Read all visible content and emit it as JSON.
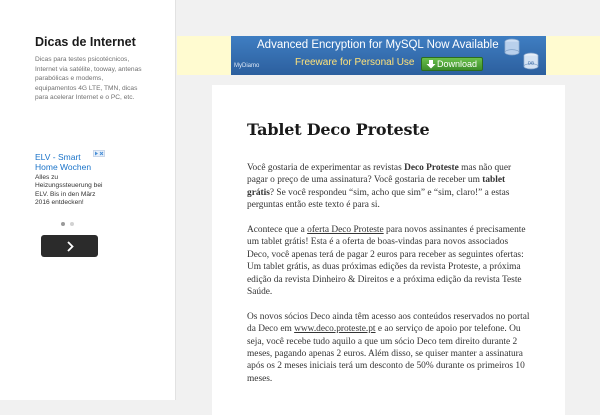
{
  "site": {
    "title": "Dicas de Internet",
    "description": "Dicas para testes psicotécnicos, Internet via satélite, tooway, antenas parabólicas e modems, equipamentos 4G LTE, TMN, dicas para acelerar Internet e o PC, etc."
  },
  "sidebar_ad": {
    "title": "ELV - Smart Home Wochen",
    "text": "Alles zu Heizungssteuerung bei ELV. Bis in den März 2016 entdecken!",
    "adchoices_icon": "adchoices-icon",
    "dots": 2,
    "active_dot": 0,
    "next_icon": "chevron-right-icon"
  },
  "banner_ad": {
    "headline": "Advanced Encryption for MySQL Now Available",
    "subline": "Freeware for Personal Use",
    "logo": "MyDiamo",
    "button": "Download",
    "db_label": "DB",
    "colors": {
      "background": "#fffbd0",
      "ad_blue": "#2c5f9e",
      "subline": "#ffe27a",
      "button": "#4ea637"
    }
  },
  "post": {
    "title": "Tablet Deco Proteste",
    "p1": {
      "t1": "Você gostaria de experimentar as revistas ",
      "b1": "Deco Proteste",
      "t2": " mas não quer pagar o preço de uma assinatura? Você gostaria de receber um ",
      "b2": "tablet grátis",
      "t3": "? Se você respondeu “sim, acho que sim” e “sim, claro!” a estas perguntas então este texto é para si."
    },
    "p2": {
      "t1": "Acontece que a ",
      "link": "oferta Deco Proteste",
      "t2": " para novos assinantes é precisamente um tablet grátis! Esta é a oferta de boas-vindas para novos associados Deco, você apenas terá de pagar 2 euros para receber as seguintes ofertas: Um tablet grátis, as duas próximas edições da revista Proteste, a próxima edição da revista Dinheiro & Direitos e a próxima edição da revista Teste Saúde."
    },
    "p3": {
      "t1": "Os novos sócios Deco ainda têm acesso aos conteúdos reservados no portal da Deco em ",
      "link": "www.deco.proteste.pt",
      "t2": " e ao serviço de apoio por telefone. Ou seja, você recebe tudo aquilo a que um sócio Deco tem direito durante 2 meses, pagando apenas 2 euros. Além disso, se quiser manter a assinatura após os 2 meses iniciais terá um desconto de 50% durante os primeiros 10 meses."
    }
  }
}
